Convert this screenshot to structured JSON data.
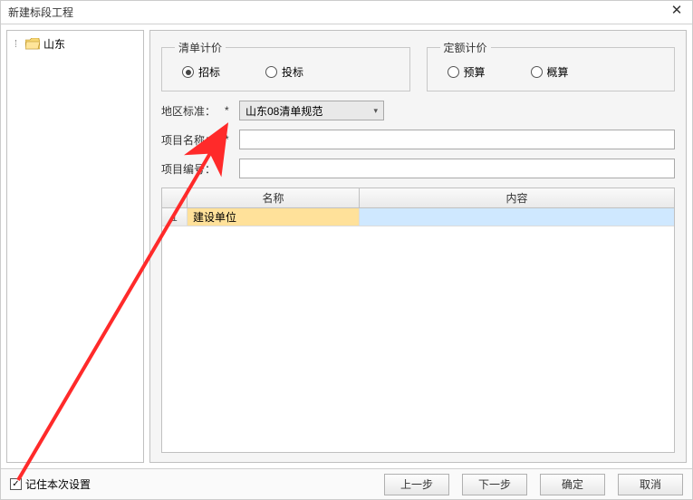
{
  "title": "新建标段工程",
  "tree": {
    "root_label": "山东"
  },
  "pricing_list": {
    "legend": "清单计价",
    "options": [
      "招标",
      "投标"
    ],
    "selected": "招标"
  },
  "pricing_quota": {
    "legend": "定额计价",
    "options": [
      "预算",
      "概算"
    ],
    "selected": ""
  },
  "form": {
    "region_label": "地区标准：",
    "region_value": "山东08清单规范",
    "project_name_label": "项目名称：",
    "project_name_value": "",
    "project_no_label": "项目编号：",
    "project_no_value": ""
  },
  "table": {
    "headers": {
      "idx": "",
      "name": "名称",
      "content": "内容"
    },
    "rows": [
      {
        "idx": "1",
        "name": "建设单位",
        "content": ""
      }
    ]
  },
  "footer": {
    "remember_label": "记住本次设置",
    "remember_checked": true,
    "buttons": {
      "prev": "上一步",
      "next": "下一步",
      "ok": "确定",
      "cancel": "取消"
    }
  }
}
